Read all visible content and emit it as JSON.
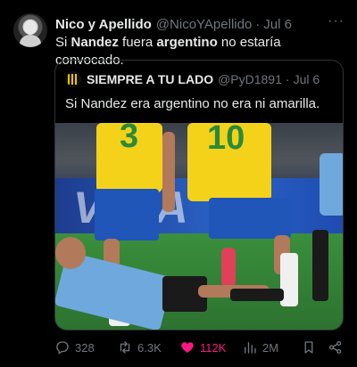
{
  "tweet": {
    "author_name": "Nico y Apellido",
    "author_handle": "@NicoYApellido",
    "separator": "·",
    "date": "Jul 6",
    "more": "···",
    "text_parts": [
      "Si ",
      "Nandez",
      " fuera ",
      "argentino",
      " no estaría convocado."
    ]
  },
  "quote": {
    "author_name": "SIEMPRE A TU LADO",
    "author_handle": "@PyD1891",
    "separator": "·",
    "date": "Jul 6",
    "text": "Si Nandez era argentino no era ni amarilla."
  },
  "photo": {
    "ad_text": "VISA",
    "jersey_numbers": [
      "3",
      "10"
    ]
  },
  "actions": {
    "replies": "328",
    "retweets": "6.3K",
    "likes": "112K",
    "views": "2M"
  },
  "colors": {
    "like_active": "#f91880",
    "muted": "#71767b",
    "text": "#e7e9ea"
  }
}
